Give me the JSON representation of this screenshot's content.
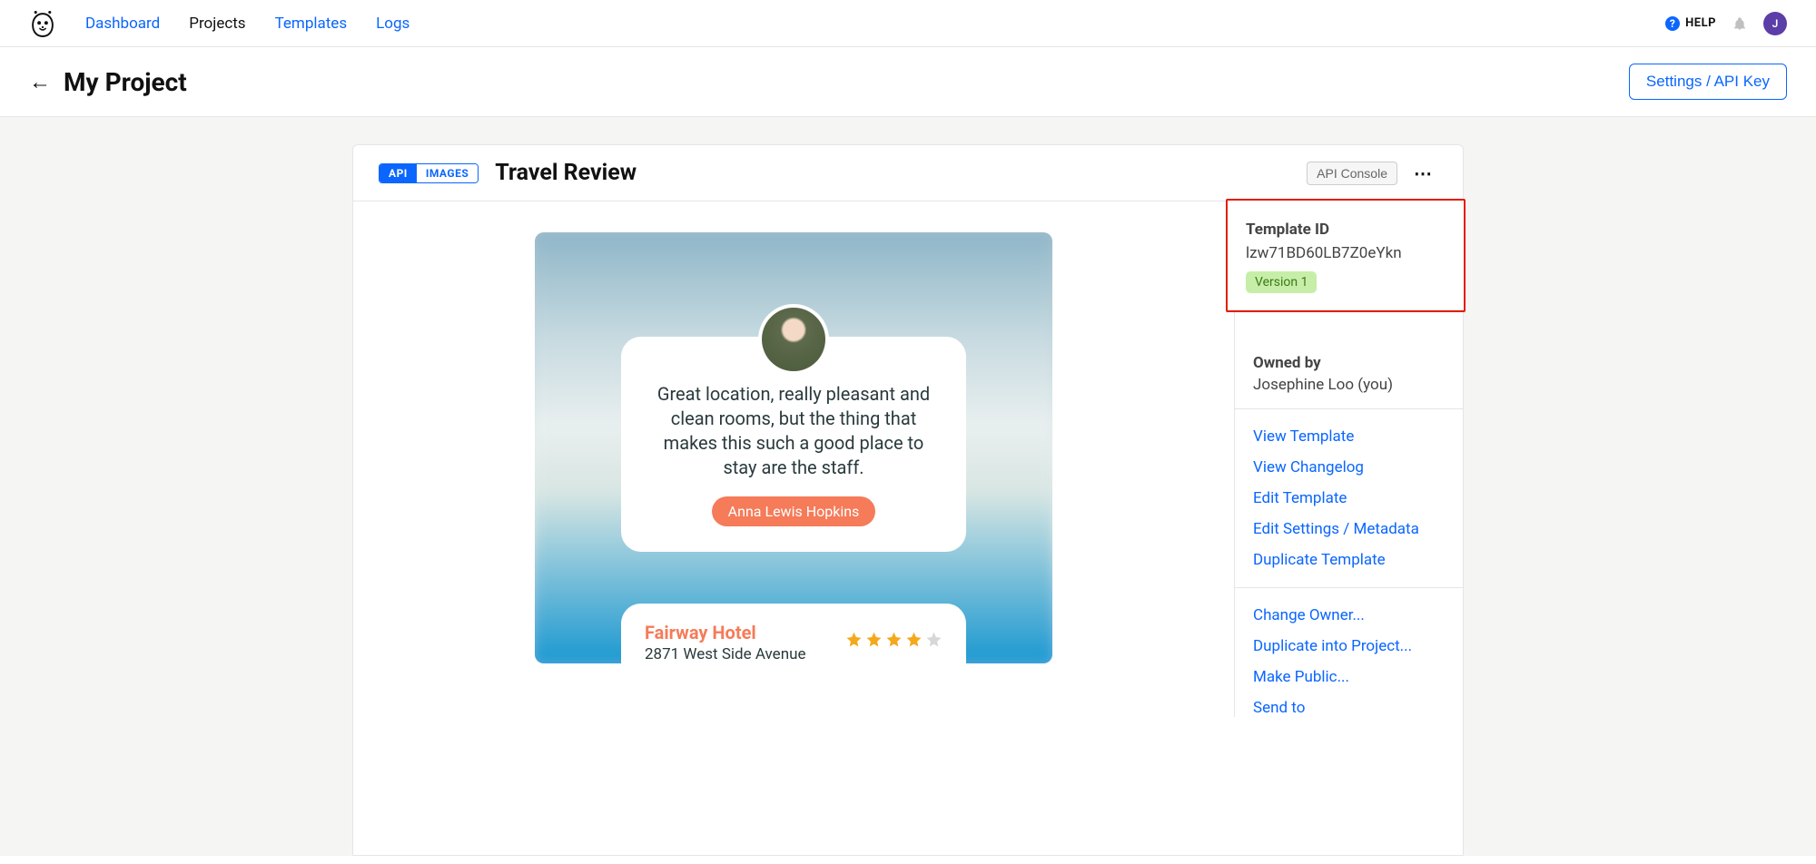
{
  "nav": {
    "dashboard": "Dashboard",
    "projects": "Projects",
    "templates": "Templates",
    "logs": "Logs",
    "help": "HELP",
    "avatar_initial": "J"
  },
  "subheader": {
    "title": "My Project",
    "settings_btn": "Settings / API Key"
  },
  "segmented": {
    "api": "API",
    "images": "IMAGES"
  },
  "template_name": "Travel Review",
  "api_console": "API Console",
  "review": {
    "text": "Great location, really pleasant and clean rooms, but the thing that makes this such a good place to stay are the staff.",
    "reviewer": "Anna Lewis Hopkins"
  },
  "hotel": {
    "name": "Fairway Hotel",
    "address": "2871 West Side Avenue",
    "rating": 4
  },
  "sidebar": {
    "template_id_label": "Template ID",
    "template_id": "lzw71BD60LB7Z0eYkn",
    "version": "Version 1",
    "owned_by_label": "Owned by",
    "owner": "Josephine Loo (you)",
    "links1": {
      "view_template": "View Template",
      "view_changelog": "View Changelog",
      "edit_template": "Edit Template",
      "edit_settings": "Edit Settings / Metadata",
      "duplicate_template": "Duplicate Template"
    },
    "links2": {
      "change_owner": "Change Owner...",
      "duplicate_into": "Duplicate into Project...",
      "make_public": "Make Public...",
      "send_to": "Send to"
    }
  }
}
